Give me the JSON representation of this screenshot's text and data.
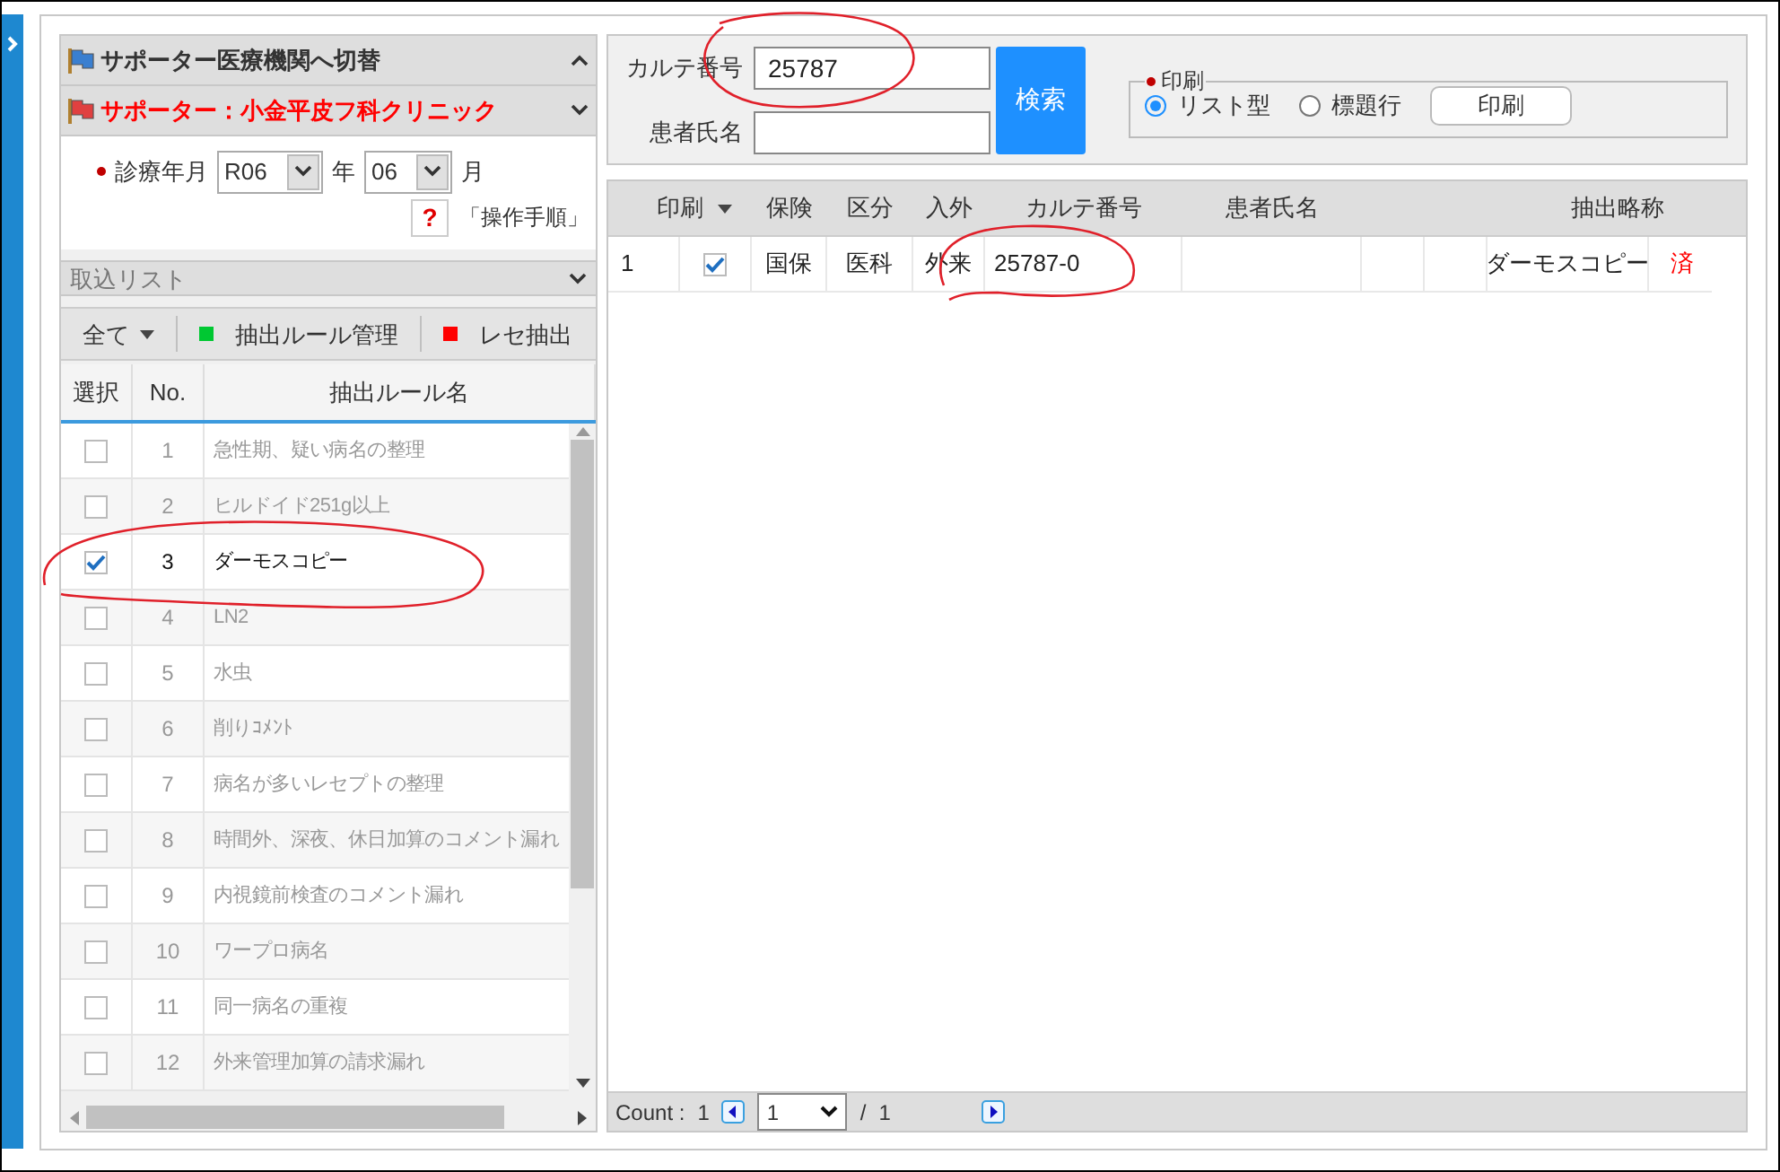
{
  "switch_panel": {
    "title": "サポーター医療機関へ切替",
    "expanded": true
  },
  "supporter_panel": {
    "title": "サポーター：小金平皮フ科クリニック",
    "expanded": false
  },
  "period": {
    "label": "診療年月",
    "year": "R06",
    "year_unit": "年",
    "month": "06",
    "month_unit": "月"
  },
  "help": {
    "icon": "?",
    "label": "「操作手順」"
  },
  "import_list": {
    "title": "取込リスト",
    "expanded": false
  },
  "toolbar": [
    {
      "kind": "dropdown",
      "label": "全て"
    },
    {
      "kind": "action",
      "label": "抽出ルール管理",
      "color": "#00c832"
    },
    {
      "kind": "action",
      "label": "レセ抽出",
      "color": "#ff0000"
    }
  ],
  "rules_table": {
    "columns": [
      "選択",
      "No.",
      "抽出ルール名"
    ],
    "rows": [
      {
        "no": "1",
        "name": "急性期、疑い病名の整理",
        "checked": false
      },
      {
        "no": "2",
        "name": "ヒルドイド251g以上",
        "checked": false
      },
      {
        "no": "3",
        "name": "ダーモスコピー",
        "checked": true
      },
      {
        "no": "4",
        "name": "LN2",
        "checked": false
      },
      {
        "no": "5",
        "name": "水虫",
        "checked": false
      },
      {
        "no": "6",
        "name": "削りｺﾒﾝﾄ",
        "checked": false
      },
      {
        "no": "7",
        "name": "病名が多いレセプトの整理",
        "checked": false
      },
      {
        "no": "8",
        "name": "時間外、深夜、休日加算のコメント漏れ",
        "checked": false
      },
      {
        "no": "9",
        "name": "内視鏡前検査のコメント漏れ",
        "checked": false
      },
      {
        "no": "10",
        "name": "ワープロ病名",
        "checked": false
      },
      {
        "no": "11",
        "name": "同一病名の重複",
        "checked": false
      },
      {
        "no": "12",
        "name": "外来管理加算の請求漏れ",
        "checked": false
      }
    ]
  },
  "search": {
    "chart_label": "カルテ番号",
    "chart_value": "25787",
    "name_label": "患者氏名",
    "button": "検索"
  },
  "print": {
    "legend": "印刷",
    "options": [
      {
        "label": "リスト型",
        "selected": true
      },
      {
        "label": "標題行",
        "selected": false
      }
    ],
    "button": "印刷"
  },
  "results": {
    "columns": [
      "印刷",
      "保険",
      "区分",
      "入外",
      "カルテ番号",
      "患者氏名",
      "抽出略称"
    ],
    "rows": [
      {
        "index": "1",
        "checked": true,
        "insurance": "国保",
        "category": "医科",
        "in_out": "外来",
        "chart_no": "25787-0",
        "abbreviation": "ダーモスコピー",
        "status": "済"
      }
    ]
  },
  "pager": {
    "count_label": "Count :",
    "count": "1",
    "page": "1",
    "separator": "/",
    "total": "1"
  }
}
